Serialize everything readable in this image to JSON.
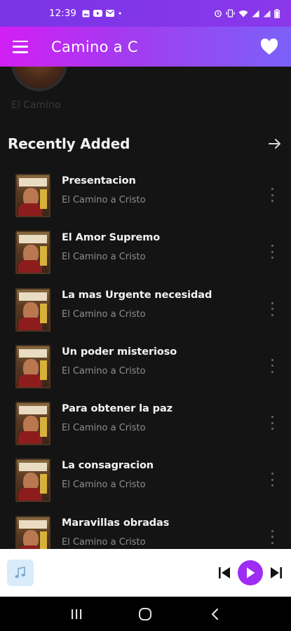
{
  "status_bar": {
    "time": "12:39",
    "left_icons": [
      "image-icon",
      "youtube-icon",
      "mail-icon",
      "dot-icon"
    ],
    "right_icons": [
      "alarm-icon",
      "vibrate-icon",
      "wifi-icon",
      "signal-icon",
      "signal-icon",
      "battery-icon"
    ]
  },
  "app_bar": {
    "title": "Camino a C",
    "colors": {
      "start": "#d21ff4",
      "mid": "#a23cf0",
      "end": "#7b61f7"
    }
  },
  "partial_item": {
    "label": "El Camino"
  },
  "recently_added": {
    "title": "Recently Added",
    "items": [
      {
        "title": "Presentacion",
        "subtitle": "El Camino a Cristo"
      },
      {
        "title": "El Amor Supremo",
        "subtitle": "El Camino a Cristo"
      },
      {
        "title": "La mas Urgente necesidad",
        "subtitle": "El Camino a Cristo"
      },
      {
        "title": "Un poder misterioso",
        "subtitle": "El Camino a Cristo"
      },
      {
        "title": "Para obtener la paz",
        "subtitle": "El Camino a Cristo"
      },
      {
        "title": "La consagracion",
        "subtitle": "El Camino a Cristo"
      },
      {
        "title": "Maravillas obradas",
        "subtitle": "El Camino a Cristo"
      }
    ]
  },
  "player": {
    "accent": "#9f2cf2"
  },
  "nav": {
    "buttons": [
      "recents-icon",
      "home-icon",
      "back-icon"
    ]
  }
}
